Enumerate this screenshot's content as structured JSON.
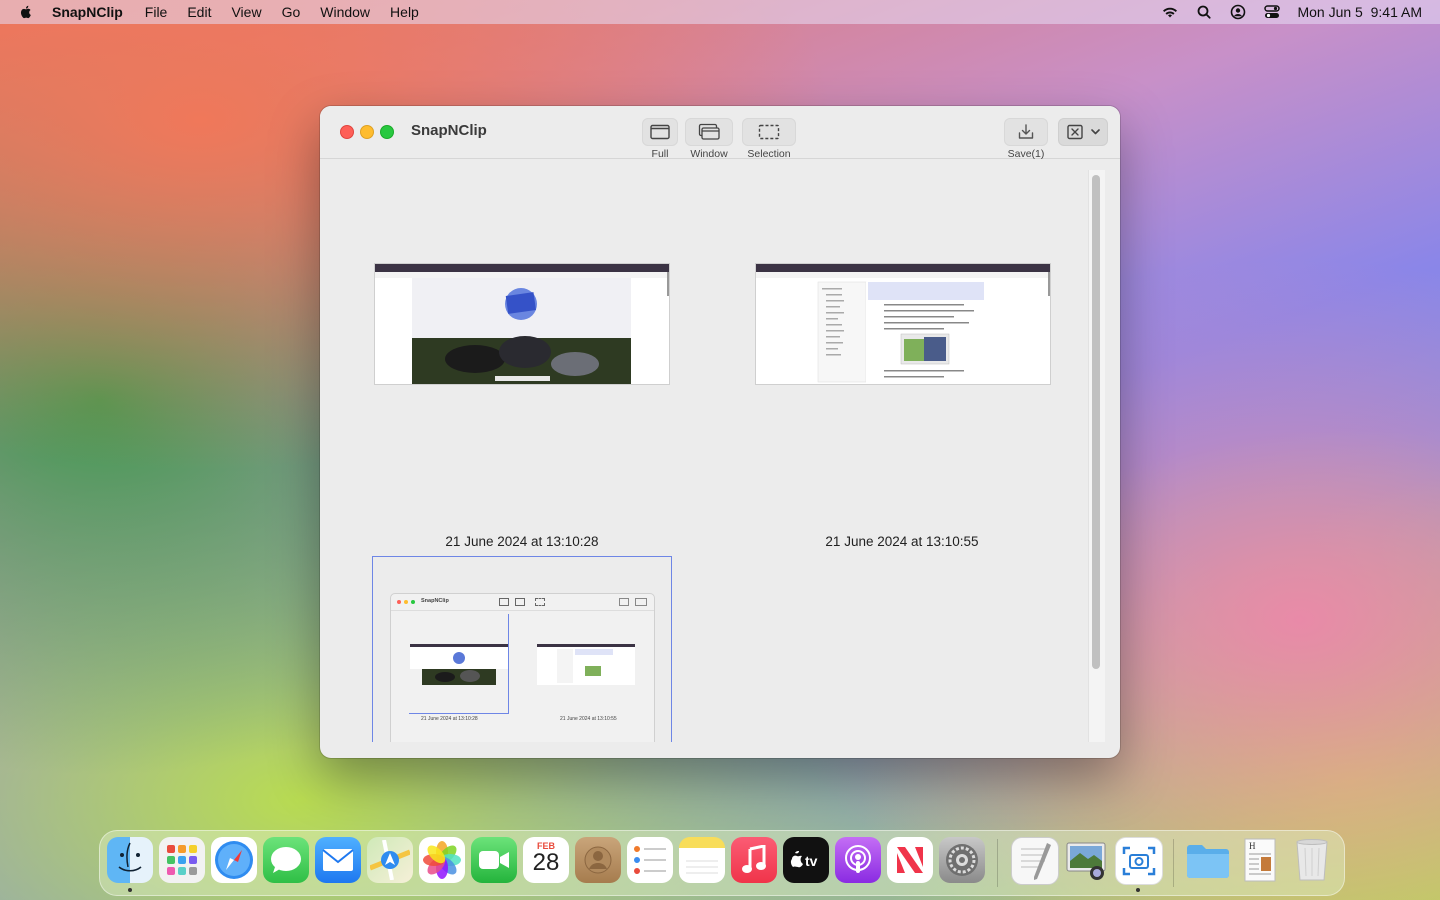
{
  "menubar": {
    "app_name": "SnapNClip",
    "items": [
      "File",
      "Edit",
      "View",
      "Go",
      "Window",
      "Help"
    ],
    "clock": "Mon Jun 5  9:41 AM",
    "status_icons": [
      "wifi-icon",
      "search-icon",
      "user-icon",
      "control-center-icon"
    ]
  },
  "window": {
    "title": "SnapNClip",
    "toolbar": {
      "full_label": "Full",
      "window_label": "Window",
      "selection_label": "Selection",
      "save_label": "Save(1)"
    },
    "captures": [
      {
        "caption": "21 June 2024 at 13:10:28",
        "selected": false
      },
      {
        "caption": "21 June 2024 at 13:10:55",
        "selected": false
      },
      {
        "caption": "",
        "selected": true
      }
    ],
    "nested": {
      "title": "SnapNClip",
      "caption1": "21 June 2024 at 13:10:28",
      "caption2": "21 June 2024 at 13:10:55"
    }
  },
  "dock": {
    "calendar_month": "FEB",
    "calendar_day": "28",
    "apps": [
      "Finder",
      "Launchpad",
      "Safari",
      "Messages",
      "Mail",
      "Maps",
      "Photos",
      "FaceTime",
      "Calendar",
      "Contacts",
      "Reminders",
      "Notes",
      "Music",
      "TV",
      "Podcasts",
      "News",
      "System Settings",
      "TextEdit",
      "Preview",
      "SnapNClip",
      "Folder",
      "Document",
      "Trash"
    ]
  },
  "colors": {
    "selection_border": "#6e86e6",
    "traffic_red": "#fe5f57",
    "traffic_yellow": "#febc2e",
    "traffic_green": "#28c840"
  }
}
